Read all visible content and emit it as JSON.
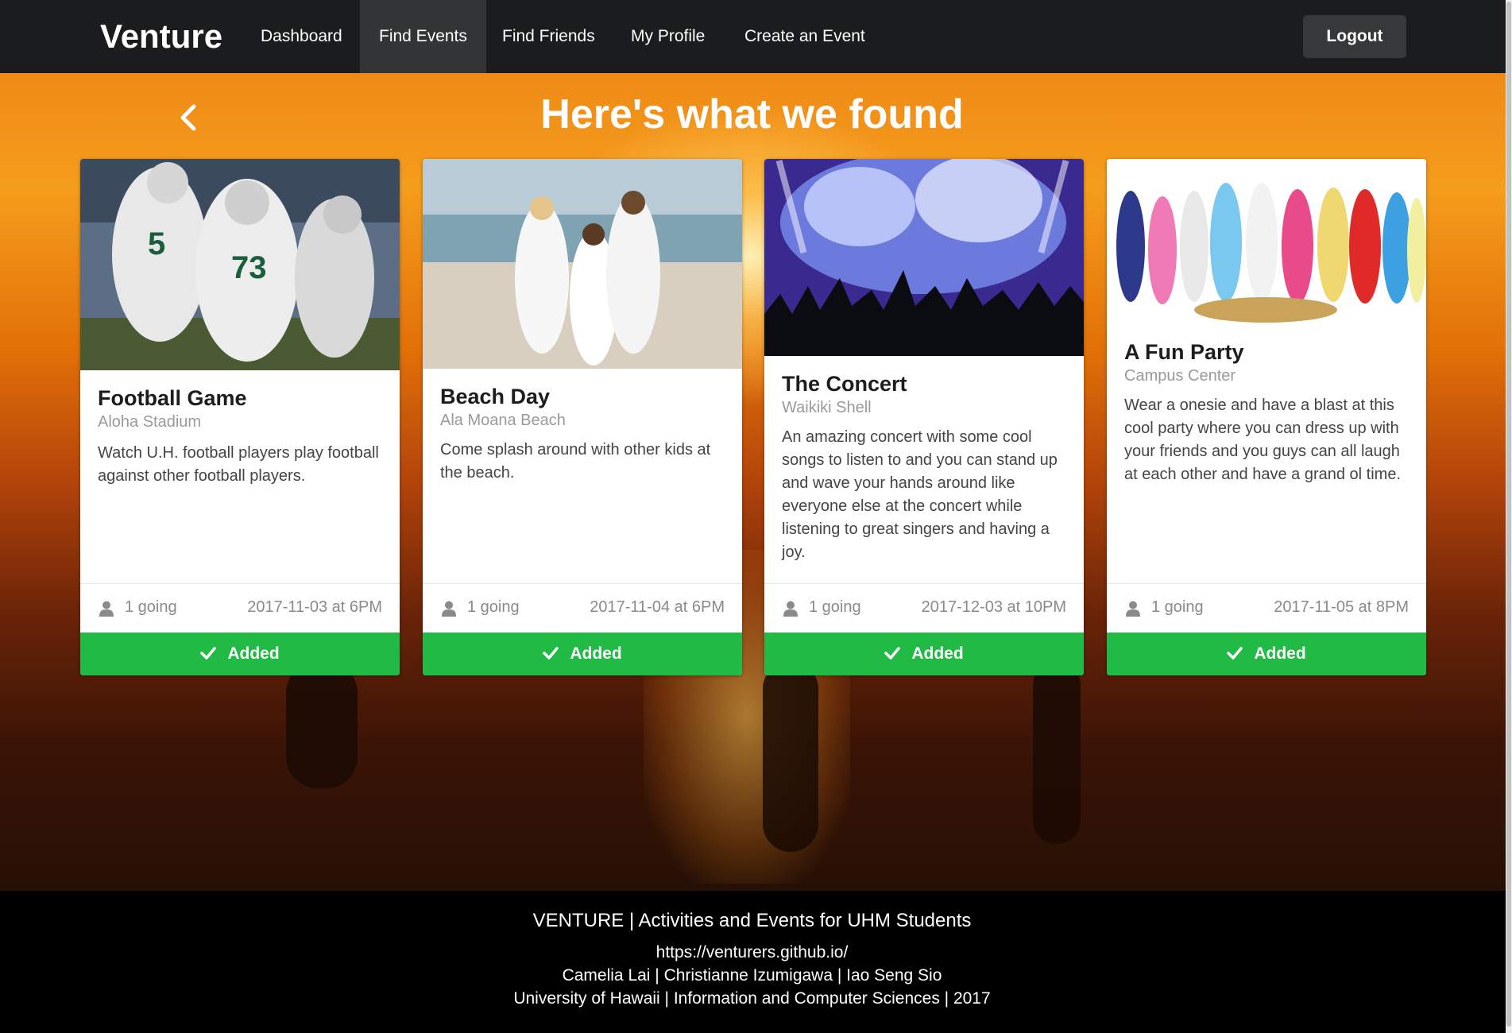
{
  "nav": {
    "brand": "Venture",
    "items": [
      {
        "label": "Dashboard",
        "active": false
      },
      {
        "label": "Find Events",
        "active": true
      },
      {
        "label": "Find Friends",
        "active": false
      },
      {
        "label": "My Profile",
        "active": false
      },
      {
        "label": "Create an Event",
        "active": false
      }
    ],
    "logout_label": "Logout"
  },
  "hero": {
    "title": "Here's what we found",
    "back_icon": "chevron-left-icon"
  },
  "events": [
    {
      "title": "Football Game",
      "location": "Aloha Stadium",
      "description": "Watch U.H. football players play football against other football players.",
      "going": "1 going",
      "date": "2017-11-03 at 6PM",
      "button_label": "Added",
      "image": "football-players-photo"
    },
    {
      "title": "Beach Day",
      "location": "Ala Moana Beach",
      "description": "Come splash around with other kids at the beach.",
      "going": "1 going",
      "date": "2017-11-04 at 6PM",
      "button_label": "Added",
      "image": "beach-people-photo"
    },
    {
      "title": "The Concert",
      "location": "Waikiki Shell",
      "description": "An amazing concert with some cool songs to listen to and you can stand up and wave your hands around like everyone else at the concert while listening to great singers and having a joy.",
      "going": "1 going",
      "date": "2017-12-03 at 10PM",
      "button_label": "Added",
      "image": "concert-crowd-photo"
    },
    {
      "title": "A Fun Party",
      "location": "Campus Center",
      "description": "Wear a onesie and have a blast at this cool party where you can dress up with your friends and you guys can all laugh at each other and have a grand ol time.",
      "going": "1 going",
      "date": "2017-11-05 at 8PM",
      "button_label": "Added",
      "image": "onesie-party-photo"
    }
  ],
  "footer": {
    "line1": "VENTURE | Activities and Events for UHM Students",
    "line2": "https://venturers.github.io/",
    "line3": "Camelia Lai | Christianne Izumigawa | Iao Seng Sio",
    "line4": "University of Hawaii | Information and Computer Sciences | 2017"
  },
  "colors": {
    "navbar": "#1b1c1d",
    "active_nav": "#333435",
    "added_button": "#21ba45",
    "footer": "#000000"
  }
}
